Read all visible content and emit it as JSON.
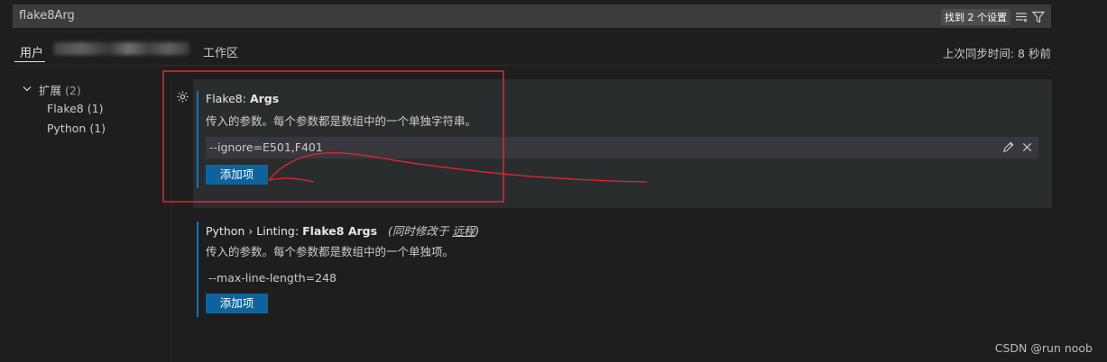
{
  "search": {
    "query": "flake8Arg",
    "result_count": "找到 2 个设置"
  },
  "tabs": {
    "user": "用户",
    "workspace": "工作区",
    "sync_status": "上次同步时间: 8 秒前"
  },
  "toc": {
    "extensions": {
      "label": "扩展",
      "count": "(2)"
    },
    "items": [
      {
        "label": "Flake8",
        "count": "(1)"
      },
      {
        "label": "Python",
        "count": "(1)"
      }
    ]
  },
  "settings": [
    {
      "title_category": "Flake8: ",
      "title_name": "Args",
      "description": "传入的参数。每个参数都是数组中的一个单独字符串。",
      "value": "--ignore=E501,F401",
      "add_button": "添加项"
    },
    {
      "title_category": "Python › Linting: ",
      "title_name": "Flake8 Args",
      "modified_note_prefix": "(同时修改于 ",
      "modified_note_link": "远程",
      "modified_note_suffix": ")",
      "description": "传入的参数。每个参数都是数组中的一个单独项。",
      "value": "--max-line-length=248",
      "add_button": "添加项"
    }
  ],
  "watermark": "CSDN @run noob",
  "colors": {
    "accent": "#007acc",
    "button": "#0e639c",
    "annotation": "#e8262b"
  }
}
